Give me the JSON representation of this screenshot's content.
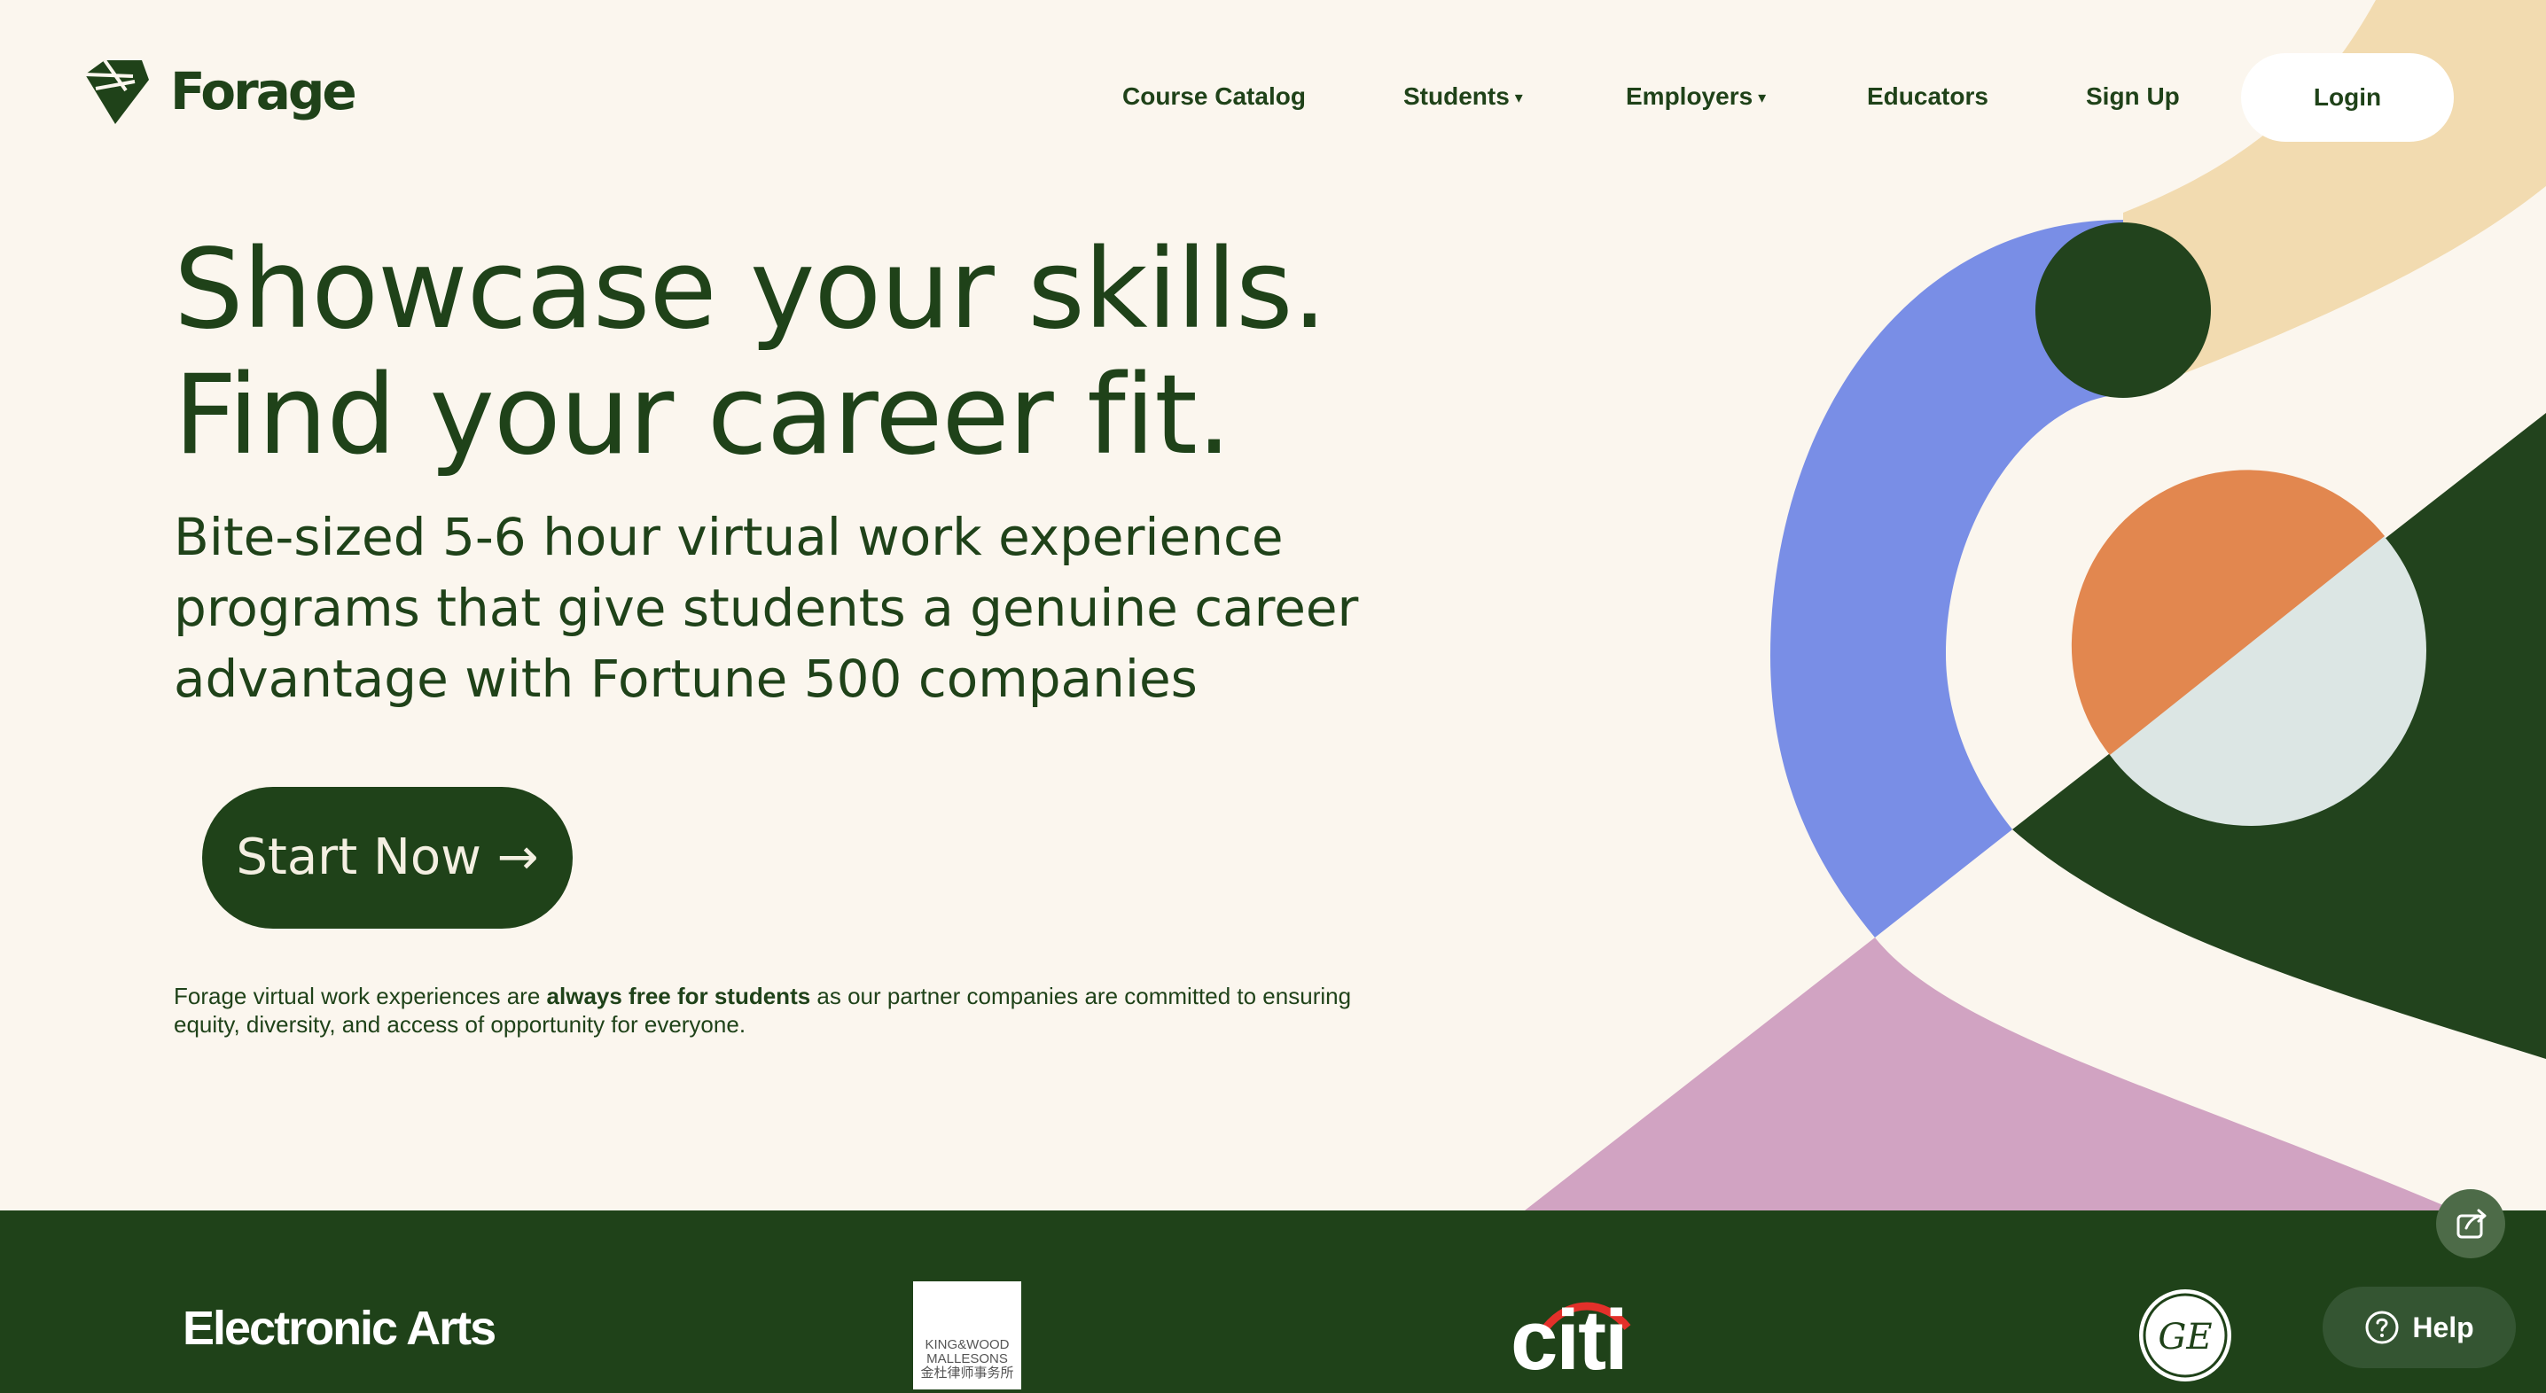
{
  "brand": {
    "name": "Forage"
  },
  "nav": {
    "items": [
      {
        "label": "Course Catalog",
        "has_dropdown": false
      },
      {
        "label": "Students",
        "has_dropdown": true
      },
      {
        "label": "Employers",
        "has_dropdown": true
      },
      {
        "label": "Educators",
        "has_dropdown": false
      },
      {
        "label": "Sign Up",
        "has_dropdown": false
      }
    ],
    "dropdown_glyph": "▾",
    "login_label": "Login"
  },
  "hero": {
    "headline_line1": "Showcase your skills.",
    "headline_line2": "Find your career fit.",
    "subhead": "Bite-sized 5-6 hour virtual work experience programs that give students a genuine career advantage with Fortune 500 companies",
    "cta_label": "Start Now →",
    "note_before": "Forage virtual work experiences are ",
    "note_bold": "always free for students",
    "note_after": " as our partner companies are committed to ensuring equity, diversity, and access of opportunity for everyone."
  },
  "partners": {
    "electronic_arts": "Electronic Arts",
    "kwm_line1": "KING&WOOD",
    "kwm_line2": "MALLESONS",
    "kwm_line3": "金杜律师事务所",
    "citi": "citi",
    "ge": "GE"
  },
  "widgets": {
    "help_label": "Help",
    "share_icon": "share-icon",
    "help_icon": "question-circle-icon"
  },
  "colors": {
    "background": "#fbf6ee",
    "dark_green": "#1f4219",
    "periwinkle": "#798ee6",
    "sand": "#f2dbb0",
    "orange": "#e2874f",
    "pale_blue": "#dce6e4",
    "pink": "#d1a3c2"
  }
}
